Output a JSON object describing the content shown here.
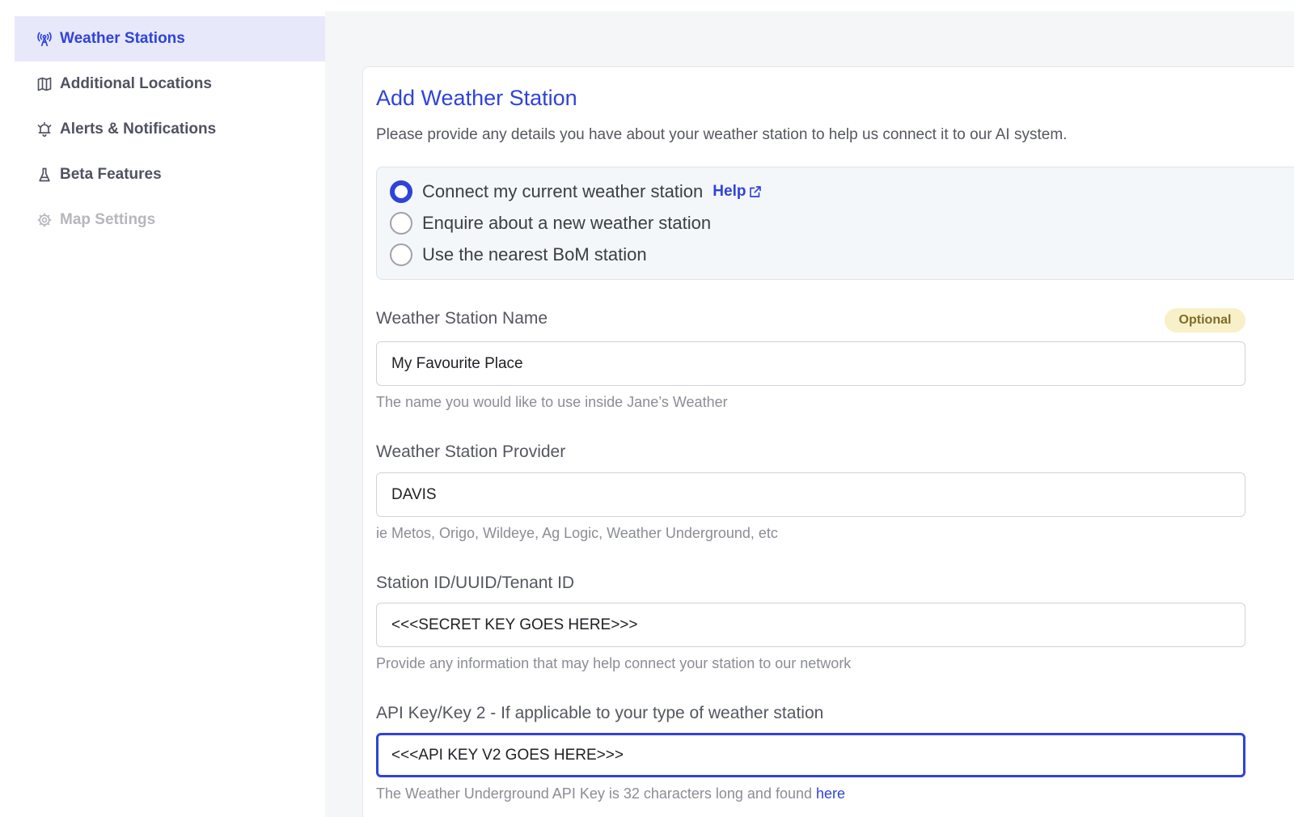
{
  "sidebar": {
    "items": [
      {
        "label": "Weather Stations",
        "icon": "antenna-icon"
      },
      {
        "label": "Additional Locations",
        "icon": "map-icon"
      },
      {
        "label": "Alerts & Notifications",
        "icon": "bell-icon"
      },
      {
        "label": "Beta Features",
        "icon": "flask-icon"
      },
      {
        "label": "Map Settings",
        "icon": "gear-icon"
      }
    ]
  },
  "form": {
    "title": "Add Weather Station",
    "subtitle": "Please provide any details you have about your weather station to help us connect it to our AI system.",
    "options": [
      {
        "label": "Connect my current weather station",
        "checked": true
      },
      {
        "label": "Enquire about a new weather station",
        "checked": false
      },
      {
        "label": "Use the nearest BoM station",
        "checked": false
      }
    ],
    "help_label": "Help",
    "optional_badge": "Optional",
    "fields": [
      {
        "label": "Weather Station Name",
        "value": "My Favourite Place",
        "hint": "The name you would like to use inside Jane’s Weather"
      },
      {
        "label": "Weather Station Provider",
        "value": "DAVIS",
        "hint": "ie Metos, Origo, Wildeye, Ag Logic, Weather Underground, etc"
      },
      {
        "label": "Station ID/UUID/Tenant ID",
        "value": "<<<SECRET KEY GOES HERE>>>",
        "hint": "Provide any information that may help connect your station to our network"
      },
      {
        "label": "API Key/Key 2 - If applicable to your type of weather station",
        "value": "<<<API KEY V2 GOES HERE>>>",
        "hint": "The Weather Underground API Key is 32 characters long and found ",
        "hint_link": "here"
      }
    ]
  },
  "colors": {
    "accent": "#2f43d9",
    "active_bg": "#e8e8fb",
    "badge_bg": "#f8f0c8"
  }
}
